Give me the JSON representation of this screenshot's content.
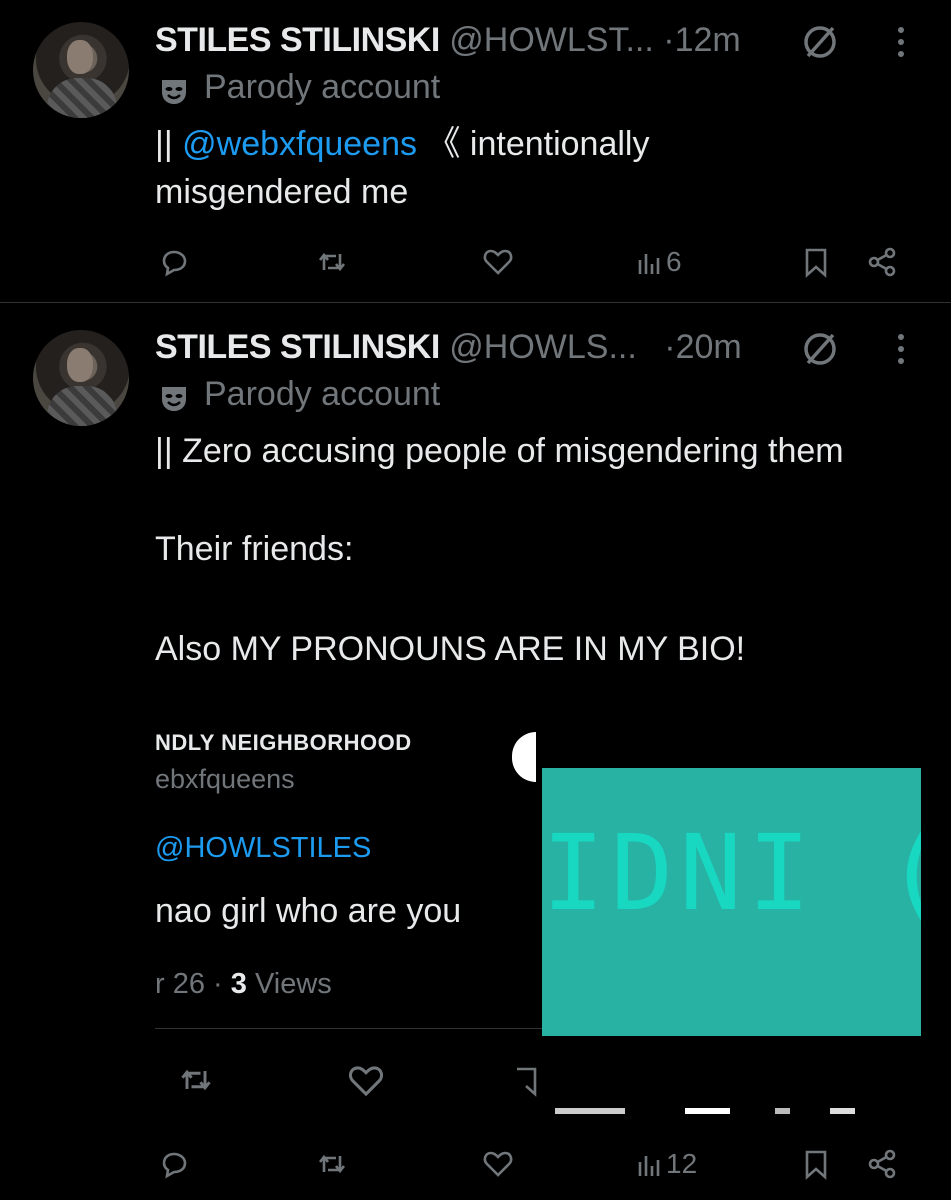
{
  "tweets": [
    {
      "name": "STILES STILINSKI",
      "handle": "@HOWLST...",
      "time": "·12m",
      "parody_label": "Parody account",
      "text_lines": [
        {
          "prefix": "|| ",
          "mention": "@webxfqueens",
          "suffix": " 《 intentionally"
        },
        {
          "text": "misgendered me"
        }
      ],
      "views": "6"
    },
    {
      "name": "STILES STILINSKI",
      "handle": "@HOWLS...",
      "time": "·20m",
      "parody_label": "Parody account",
      "text_lines": [
        "|| Zero accusing people of misgendering them",
        "Their friends:",
        "Also MY PRONOUNS ARE IN MY BIO!"
      ],
      "views": "12"
    }
  ],
  "embedded_screenshot": {
    "display_name": "NDLY NEIGHBORHOOD",
    "handle": "ebxfqueens",
    "reply_to": "@HOWLSTILES",
    "text": "nao girl who are you",
    "date": "r 26",
    "views_count": "3",
    "views_label": "Views"
  },
  "sticker": {
    "text": "IDNI (H",
    "color": "#27b2a3"
  },
  "icons": [
    "reply-icon",
    "retweet-icon",
    "like-icon",
    "views-icon",
    "bookmark-icon",
    "share-icon",
    "parody-mask-icon",
    "no-entry-icon",
    "more-icon"
  ]
}
